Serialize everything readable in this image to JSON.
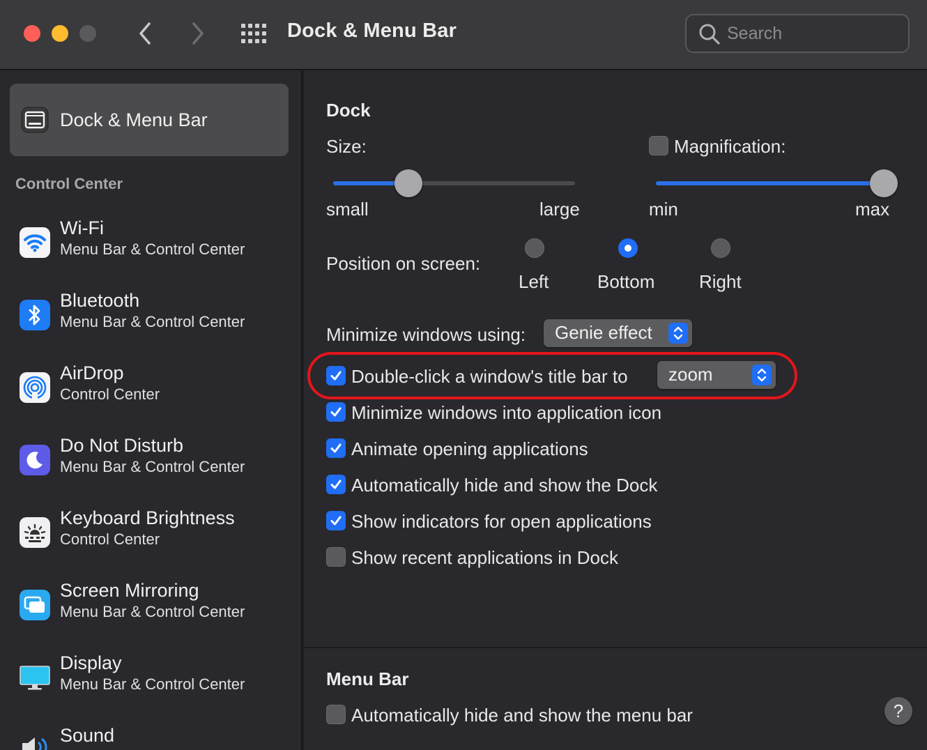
{
  "window": {
    "title": "Dock & Menu Bar"
  },
  "search": {
    "placeholder": "Search"
  },
  "icons": {
    "back": "chevron-left-icon",
    "forward": "chevron-right-icon",
    "grid": "grid-icon",
    "search": "search-icon",
    "dock": "dock-menubar-icon",
    "wifi": "wifi-icon",
    "bluetooth": "bluetooth-icon",
    "airdrop": "airdrop-icon",
    "dnd": "moon-icon",
    "keyboard": "keyboard-brightness-icon",
    "mirroring": "screen-mirroring-icon",
    "display": "display-icon",
    "sound": "speaker-icon",
    "help": "help-icon"
  },
  "colors": {
    "accent": "#1f6ef5",
    "highlight": "#e3151b",
    "traffic_red": "#fe5f57",
    "traffic_yellow": "#febc2e"
  },
  "sidebar": {
    "selected": {
      "label": "Dock & Menu Bar"
    },
    "header": "Control Center",
    "items": [
      {
        "name": "Wi-Fi",
        "sub": "Menu Bar & Control Center"
      },
      {
        "name": "Bluetooth",
        "sub": "Menu Bar & Control Center"
      },
      {
        "name": "AirDrop",
        "sub": "Control Center"
      },
      {
        "name": "Do Not Disturb",
        "sub": "Menu Bar & Control Center"
      },
      {
        "name": "Keyboard Brightness",
        "sub": "Control Center"
      },
      {
        "name": "Screen Mirroring",
        "sub": "Menu Bar & Control Center"
      },
      {
        "name": "Display",
        "sub": "Menu Bar & Control Center"
      },
      {
        "name": "Sound",
        "sub": ""
      }
    ]
  },
  "dock": {
    "title": "Dock",
    "size": {
      "label": "Size:",
      "min_label": "small",
      "max_label": "large",
      "level": 0.31
    },
    "magnification": {
      "label": "Magnification:",
      "checked": false,
      "min_label": "min",
      "max_label": "max",
      "level": 1.0
    },
    "position": {
      "label": "Position on screen:",
      "options": [
        "Left",
        "Bottom",
        "Right"
      ],
      "selected": "Bottom"
    },
    "minimize": {
      "label": "Minimize windows using:",
      "value": "Genie effect"
    },
    "double_click": {
      "label": "Double-click a window's title bar to",
      "checked": true,
      "value": "zoom"
    },
    "checkboxes": [
      {
        "label": "Minimize windows into application icon",
        "checked": true
      },
      {
        "label": "Animate opening applications",
        "checked": true
      },
      {
        "label": "Automatically hide and show the Dock",
        "checked": true
      },
      {
        "label": "Show indicators for open applications",
        "checked": true
      },
      {
        "label": "Show recent applications in Dock",
        "checked": false
      }
    ]
  },
  "menu_bar": {
    "title": "Menu Bar",
    "checkboxes": [
      {
        "label": "Automatically hide and show the menu bar",
        "checked": false
      }
    ]
  },
  "help": {
    "label": "?"
  }
}
